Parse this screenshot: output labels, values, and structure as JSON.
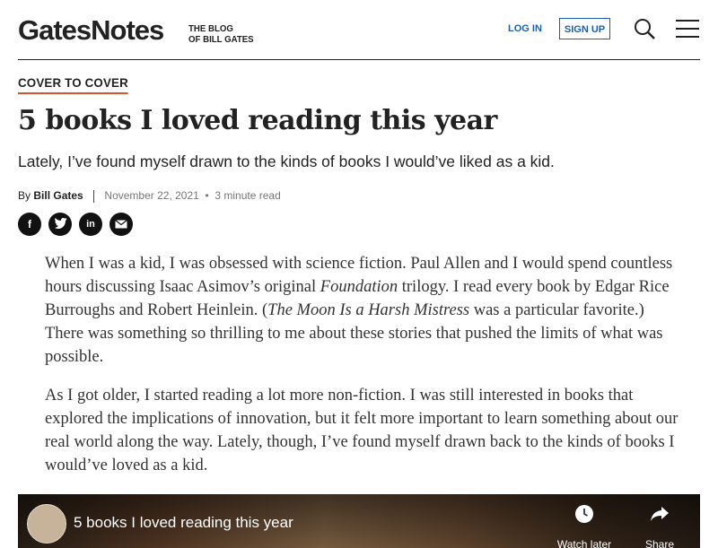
{
  "header": {
    "logo": "GatesNotes",
    "tagline_line1": "THE BLOG",
    "tagline_line2": "OF BILL GATES",
    "login_label": "LOG IN",
    "signup_label": "SIGN UP",
    "icons": [
      "search-icon",
      "hamburger-menu-icon"
    ],
    "accent_color": "#1a5fb4"
  },
  "article": {
    "section": "COVER TO COVER",
    "title": "5 books I loved reading this year",
    "subtitle": "Lately, I’ve found myself drawn to the kinds of books I would’ve liked as a kid.",
    "by_label": "By",
    "author": "Bill Gates",
    "date": "November 22, 2021",
    "dot": "•",
    "read_time": "3 minute read",
    "share_icons": [
      "facebook-icon",
      "twitter-icon",
      "linkedin-icon",
      "email-icon"
    ],
    "p1": {
      "a": "When I was a kid, I was obsessed with science fiction. Paul Allen and I would spend countless hours discussing Isaac Asimov’s original ",
      "b": "Foundation",
      "c": " trilogy. I read every book by Edgar Rice Burroughs and Robert Heinlein. (",
      "d": "The Moon Is a Harsh Mistress",
      "e": " was a particular favorite.) There was something so thrilling to me about these stories that pushed the limits of what was possible."
    },
    "p2": "As I got older, I started reading a lot more non-fiction. I was still interested in books that explored the implications of innovation, but it felt more important to learn something about our real world along the way. Lately, though, I’ve found myself drawn back to the kinds of books I would’ve loved as a kid.",
    "section_underline_color": "#d9532c"
  },
  "video": {
    "title": "5 books I loved reading this year",
    "watch_later_label": "Watch later",
    "share_label": "Share"
  }
}
